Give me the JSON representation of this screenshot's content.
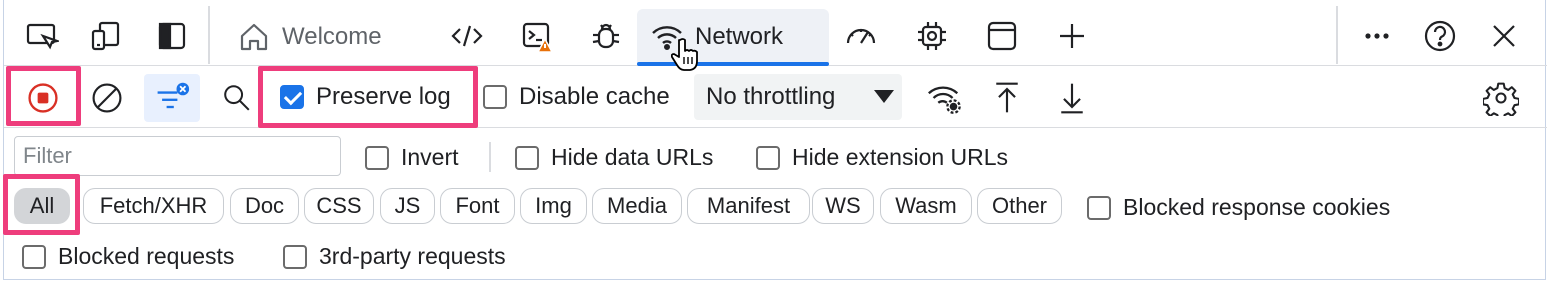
{
  "tabs": {
    "welcome_label": "Welcome",
    "network_label": "Network"
  },
  "toolbar": {
    "preserve_log_label": "Preserve log",
    "preserve_log_checked": true,
    "disable_cache_label": "Disable cache",
    "disable_cache_checked": false,
    "throttling_value": "No throttling"
  },
  "filter": {
    "placeholder": "Filter",
    "invert_label": "Invert",
    "hide_data_urls_label": "Hide data URLs",
    "hide_extension_urls_label": "Hide extension URLs"
  },
  "type_filters": [
    "All",
    "Fetch/XHR",
    "Doc",
    "CSS",
    "JS",
    "Font",
    "Img",
    "Media",
    "Manifest",
    "WS",
    "Wasm",
    "Other"
  ],
  "active_type_filter": "All",
  "extra_filters": {
    "blocked_response_cookies_label": "Blocked response cookies",
    "blocked_requests_label": "Blocked requests",
    "third_party_requests_label": "3rd-party requests"
  },
  "colors": {
    "accent": "#1a73e8",
    "highlight": "#ee3d7c",
    "record": "#d93025",
    "warning": "#e8710a"
  },
  "icons": [
    "device-toolbar-icon",
    "device-mode-icon",
    "dock-sidebar-icon",
    "home-icon",
    "elements-code-icon",
    "console-icon",
    "bug-icon",
    "wifi-icon",
    "performance-gauge-icon",
    "cpu-chip-icon",
    "application-window-icon",
    "plus-icon",
    "more-icon",
    "help-icon",
    "close-icon",
    "record-icon",
    "clear-icon",
    "filter-icon",
    "search-icon",
    "network-conditions-icon",
    "upload-icon",
    "download-icon",
    "settings-gear-icon"
  ]
}
